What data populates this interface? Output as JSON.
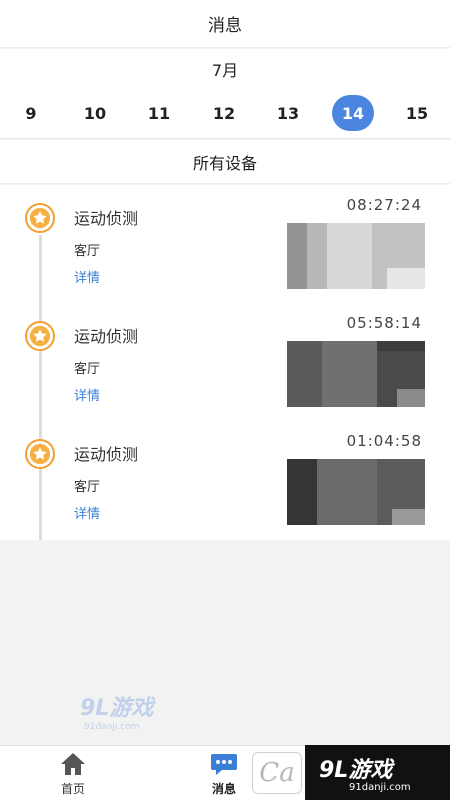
{
  "header": {
    "title": "消息"
  },
  "calendar": {
    "month": "7月",
    "days": [
      "9",
      "10",
      "11",
      "12",
      "13",
      "14",
      "15"
    ],
    "selected": "14"
  },
  "filter": {
    "label": "所有设备"
  },
  "events": [
    {
      "title": "运动侦测",
      "location": "客厅",
      "detail": "详情",
      "time": "08:27:24"
    },
    {
      "title": "运动侦测",
      "location": "客厅",
      "detail": "详情",
      "time": "05:58:14"
    },
    {
      "title": "运动侦测",
      "location": "客厅",
      "detail": "详情",
      "time": "01:04:58"
    }
  ],
  "tabbar": {
    "home": "首页",
    "messages": "消息"
  },
  "watermark": {
    "brand": "9L游戏",
    "domain": "91danji.com",
    "corner_letter": "Ca"
  },
  "colors": {
    "accent": "#4a86e0",
    "star": "#f0a030",
    "link": "#3a7fd5"
  }
}
